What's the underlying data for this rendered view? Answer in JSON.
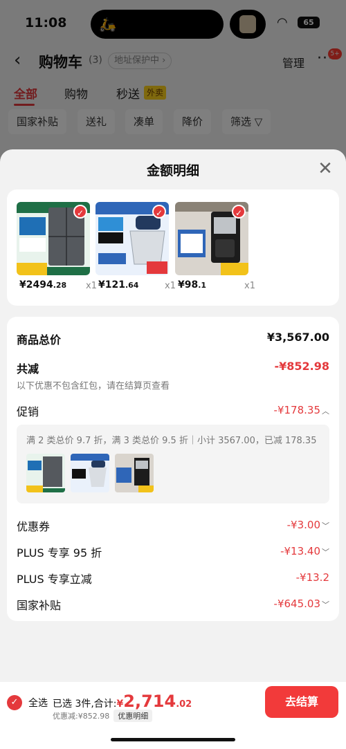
{
  "status": {
    "time": "11:08",
    "battery": "65"
  },
  "nav": {
    "title": "购物车",
    "count": "(3)",
    "address": "地址保护中 ›",
    "manage": "管理",
    "more": "···",
    "badge": "5+"
  },
  "tabs": [
    {
      "label": "全部"
    },
    {
      "label": "购物"
    },
    {
      "label": "秒送"
    }
  ],
  "tab_tag": "外卖",
  "filters": [
    "国家补贴",
    "送礼",
    "凑单",
    "降价",
    "筛选 ▽"
  ],
  "sheet": {
    "title": "金额明细",
    "close": "✕"
  },
  "products": [
    {
      "price_int": "¥2494",
      "price_dec": ".28",
      "qty": "x1",
      "thumb_color": "#2e7d4f"
    },
    {
      "price_int": "¥121",
      "price_dec": ".64",
      "qty": "x1",
      "thumb_color": "#3a6fb5"
    },
    {
      "price_int": "¥98",
      "price_dec": ".1",
      "qty": "x1",
      "thumb_color": "#4a4a4a"
    }
  ],
  "detail": {
    "total_label": "商品总价",
    "total_value": "¥3,567.00",
    "reduce_label": "共减",
    "reduce_value": "-¥852.98",
    "reduce_note": "以下优惠不包含红包，请在结算页查看",
    "promo_label": "促销",
    "promo_value": "-¥178.35",
    "promo_text": "满 2 类总价 9.7 折，满 3 类总价 9.5 折｜小计 3567.00，已减 178.35",
    "coupon_label": "优惠券",
    "coupon_value": "-¥3.00",
    "plus95_label": "PLUS 专享 95 折",
    "plus95_value": "-¥13.40",
    "plusreduce_label": "PLUS 专享立减",
    "plusreduce_value": "-¥13.2",
    "subsidy_label": "国家补贴",
    "subsidy_value": "-¥645.03"
  },
  "bottom": {
    "all_label": "全选",
    "selected_text": "已选 3件,合计:",
    "yen": "¥",
    "total_int": "2,714",
    "total_dec": ".02",
    "discount_text": "优惠减:¥852.98",
    "detail_chip": "优惠明细",
    "checkout": "去结算"
  }
}
